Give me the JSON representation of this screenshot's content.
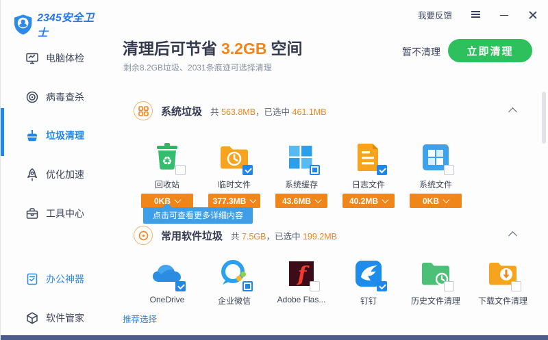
{
  "window": {
    "feedback_label": "我要反馈"
  },
  "sidebar": {
    "logo_text": "2345安全卫士",
    "items": [
      {
        "label": "电脑体检",
        "icon": "monitor-icon"
      },
      {
        "label": "病毒查杀",
        "icon": "target-icon"
      },
      {
        "label": "垃圾清理",
        "icon": "broom-icon",
        "selected": true
      },
      {
        "label": "优化加速",
        "icon": "rocket-icon"
      },
      {
        "label": "工具中心",
        "icon": "toolbox-icon"
      },
      {
        "label": "办公神器",
        "icon": "document-check-icon",
        "highlight": true
      },
      {
        "label": "软件管家",
        "icon": "cube-icon"
      }
    ]
  },
  "header": {
    "title_prefix": "清理后可节省",
    "title_highlight": "3.2GB",
    "title_suffix": "空间",
    "subtitle": "剩余8.2GB垃圾、2031条痕迹可选择清理",
    "skip_button": "暂不清理",
    "clean_button": "立即清理"
  },
  "sections": [
    {
      "title": "系统垃圾",
      "sum_label": "共",
      "total": "563.8MB",
      "sep": "，已选中",
      "selected": "461.1MB",
      "items": [
        {
          "name": "回收站",
          "size": "0KB",
          "checkbox": "unchecked",
          "icon": "recycle-bin-icon"
        },
        {
          "name": "临时文件",
          "size": "377.3MB",
          "checkbox": "checked",
          "icon": "temp-folder-icon"
        },
        {
          "name": "系统缓存",
          "size": "43.6MB",
          "checkbox": "partial",
          "icon": "windows-cache-icon"
        },
        {
          "name": "日志文件",
          "size": "40.2MB",
          "checkbox": "checked",
          "icon": "log-file-icon"
        },
        {
          "name": "系统文件",
          "size": "0KB",
          "checkbox": "unchecked",
          "icon": "system-file-icon"
        }
      ]
    },
    {
      "title": "常用软件垃圾",
      "sum_label": "共",
      "total": "7.5GB",
      "sep": "，已选中",
      "selected": "199.2MB",
      "items": [
        {
          "name": "OneDrive",
          "checkbox": "checked",
          "icon": "onedrive-icon"
        },
        {
          "name": "企业微信",
          "checkbox": "partial",
          "icon": "wecom-icon"
        },
        {
          "name": "Adobe Flas...",
          "checkbox": "unchecked",
          "icon": "flash-icon"
        },
        {
          "name": "钉钉",
          "checkbox": "checked",
          "icon": "dingtalk-icon"
        },
        {
          "name": "历史文件清理",
          "checkbox": "unchecked",
          "icon": "history-folder-icon"
        },
        {
          "name": "下载文件清理",
          "checkbox": "unchecked",
          "icon": "download-folder-icon"
        }
      ]
    }
  ],
  "tooltip": {
    "text": "点击可查看更多详细内容"
  },
  "footer": {
    "recommend_link": "推荐选择"
  },
  "colors": {
    "accent_orange": "#f08519",
    "accent_blue": "#1f86ea",
    "tooltip_blue": "#3f9ee8",
    "clean_green": "#2ec05c",
    "text_dark": "#333a4e",
    "text_gray": "#8a93a3"
  }
}
